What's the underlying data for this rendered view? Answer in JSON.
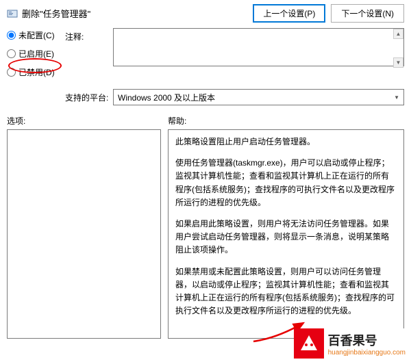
{
  "title": "删除\"任务管理器\"",
  "nav": {
    "prev": "上一个设置(P)",
    "next": "下一个设置(N)"
  },
  "radios": {
    "not_configured": "未配置(C)",
    "enabled": "已启用(E)",
    "disabled": "已禁用(D)"
  },
  "labels": {
    "comment": "注释:",
    "platform": "支持的平台:",
    "options": "选项:",
    "help": "帮助:"
  },
  "platform_value": "Windows 2000 及以上版本",
  "help_text": {
    "p1": "此策略设置阻止用户启动任务管理器。",
    "p2": "使用任务管理器(taskmgr.exe)，用户可以启动或停止程序；监视其计算机性能；查看和监视其计算机上正在运行的所有程序(包括系统服务)；查找程序的可执行文件名以及更改程序所运行的进程的优先级。",
    "p3": "如果启用此策略设置，则用户将无法访问任务管理器。如果用户尝试启动任务管理器，则将显示一条消息，说明某策略阻止该项操作。",
    "p4": "如果禁用或未配置此策略设置，则用户可以访问任务管理器，以启动或停止程序；监视其计算机性能；查看和监视其计算机上正在运行的所有程序(包括系统服务)；查找程序的可执行文件名以及更改程序所运行的进程的优先级。"
  },
  "watermark": {
    "title": "百香果号",
    "url": "huangjinbaixiangguo.com"
  }
}
